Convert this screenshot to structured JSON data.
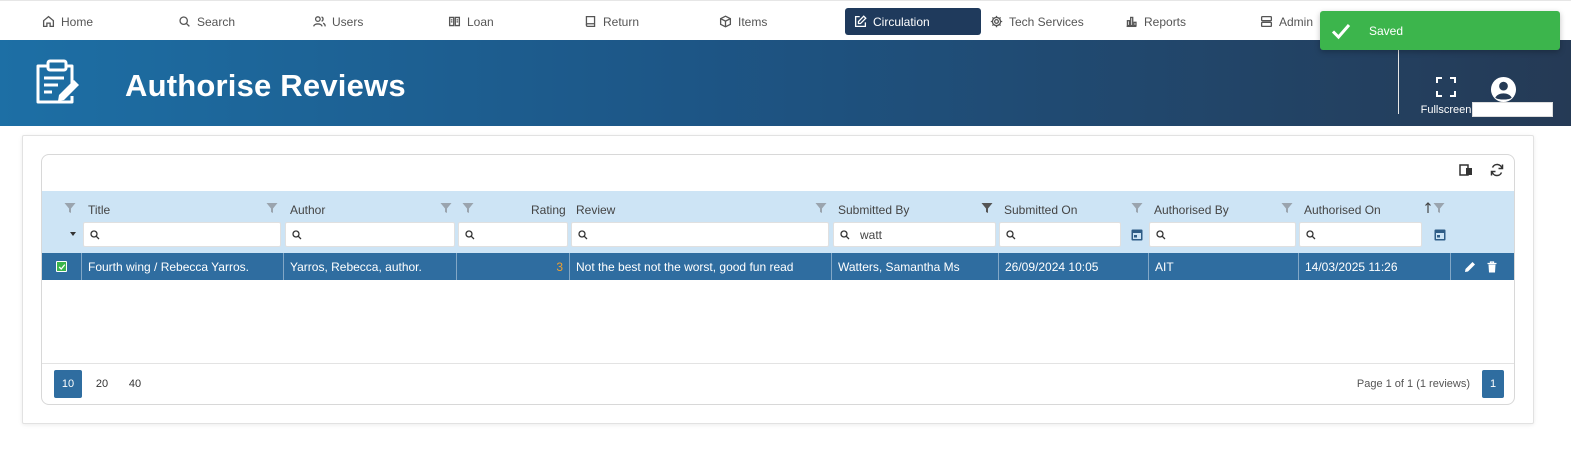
{
  "nav": {
    "items": [
      {
        "label": "Home",
        "icon": "home-icon"
      },
      {
        "label": "Search",
        "icon": "search-icon"
      },
      {
        "label": "Users",
        "icon": "users-icon"
      },
      {
        "label": "Loan",
        "icon": "book-open-icon"
      },
      {
        "label": "Return",
        "icon": "book-icon"
      },
      {
        "label": "Items",
        "icon": "box-icon"
      },
      {
        "label": "Circulation",
        "icon": "edit-icon",
        "active": true
      },
      {
        "label": "Tech Services",
        "icon": "gear-icon"
      },
      {
        "label": "Reports",
        "icon": "bar-chart-icon"
      },
      {
        "label": "Admin",
        "icon": "server-icon"
      }
    ]
  },
  "toast": {
    "message": "Saved",
    "color": "#3cb54c"
  },
  "banner": {
    "title": "Authorise Reviews",
    "fullscreen_label": "Fullscreen"
  },
  "grid": {
    "columns": [
      {
        "key": "title",
        "label": "Title",
        "filter": ""
      },
      {
        "key": "author",
        "label": "Author",
        "filter": ""
      },
      {
        "key": "rating",
        "label": "Rating",
        "filter": ""
      },
      {
        "key": "review",
        "label": "Review",
        "filter": ""
      },
      {
        "key": "submitted_by",
        "label": "Submitted By",
        "filter": "watt"
      },
      {
        "key": "submitted_on",
        "label": "Submitted On",
        "filter": ""
      },
      {
        "key": "authorised_by",
        "label": "Authorised By",
        "filter": ""
      },
      {
        "key": "authorised_on",
        "label": "Authorised On",
        "filter": "",
        "sort": "ascending"
      }
    ],
    "rows": [
      {
        "selected": true,
        "title": "Fourth wing / Rebecca Yarros.",
        "author": "Yarros, Rebecca, author.",
        "rating": "3",
        "review": "Not the best not the worst, good fun read",
        "submitted_by": "Watters, Samantha Ms",
        "submitted_on": "26/09/2024 10:05",
        "authorised_by": "AIT",
        "authorised_on": "14/03/2025 11:26"
      }
    ]
  },
  "pager": {
    "sizes": [
      "10",
      "20",
      "40"
    ],
    "active_size": "10",
    "info": "Page 1 of 1 (1 reviews)",
    "current_page": "1"
  },
  "colors": {
    "accent": "#2f6da0",
    "nav_active": "#1f3a5c",
    "header_bg": "#cde4f5",
    "rating": "#f0a030"
  }
}
